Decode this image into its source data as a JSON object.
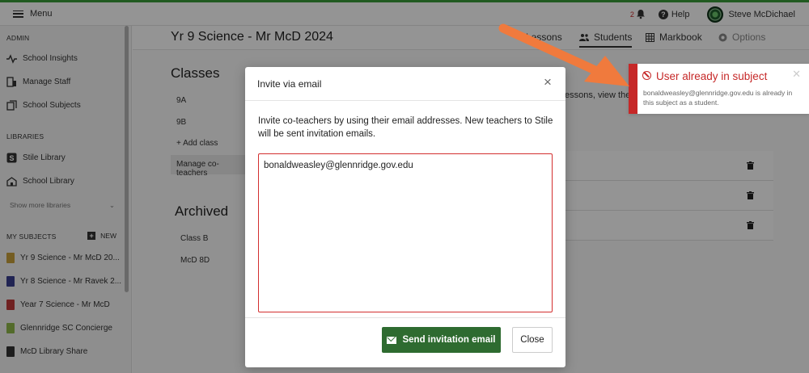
{
  "topbar": {
    "menu_label": "Menu",
    "notification_count": "2",
    "help_label": "Help",
    "user_name": "Steve McDichael"
  },
  "sidebar": {
    "admin_heading": "ADMIN",
    "admin_items": [
      "School Insights",
      "Manage Staff",
      "School Subjects"
    ],
    "libraries_heading": "LIBRARIES",
    "library_items": [
      "Stile Library",
      "School Library"
    ],
    "show_more": "Show more libraries",
    "my_subjects_heading": "MY SUBJECTS",
    "new_label": "NEW",
    "subjects": [
      {
        "label": "Yr 9 Science - Mr McD 20...",
        "color": "#c9a13b"
      },
      {
        "label": "Yr 8 Science - Mr Ravek 2...",
        "color": "#3a3f8f"
      },
      {
        "label": "Year 7 Science - Mr McD",
        "color": "#c23a3a"
      },
      {
        "label": "Glennridge SC Concierge",
        "color": "#8fb84a"
      },
      {
        "label": "McD Library Share",
        "color": "#333333"
      }
    ]
  },
  "subject": {
    "title": "Yr 9 Science - Mr McD 2024",
    "tabs": [
      "Lessons",
      "Students",
      "Markbook",
      "Options"
    ]
  },
  "classes": {
    "heading": "Classes",
    "items": [
      "9A",
      "9B"
    ],
    "add_class": "+ Add class",
    "manage_co_teachers": "Manage co-teachers",
    "hint_text": "essons, view the n",
    "archived_heading": "Archived",
    "archived_items": [
      "Class B",
      "McD 8D"
    ]
  },
  "modal": {
    "title": "Invite via email",
    "description": "Invite co-teachers by using their email addresses. New teachers to Stile will be sent invitation emails.",
    "email_value": "bonaldweasley@glennridge.gov.edu",
    "send_label": "Send invitation email",
    "close_label": "Close"
  },
  "toast": {
    "title": "User already in subject",
    "message": "bonaldweasley@glennridge.gov.edu is already in this subject as a student.",
    "color": "#c62828"
  },
  "colors": {
    "accent_green": "#2e6b30",
    "error_red": "#d32f2f",
    "annotation_orange": "#f07a3d"
  }
}
